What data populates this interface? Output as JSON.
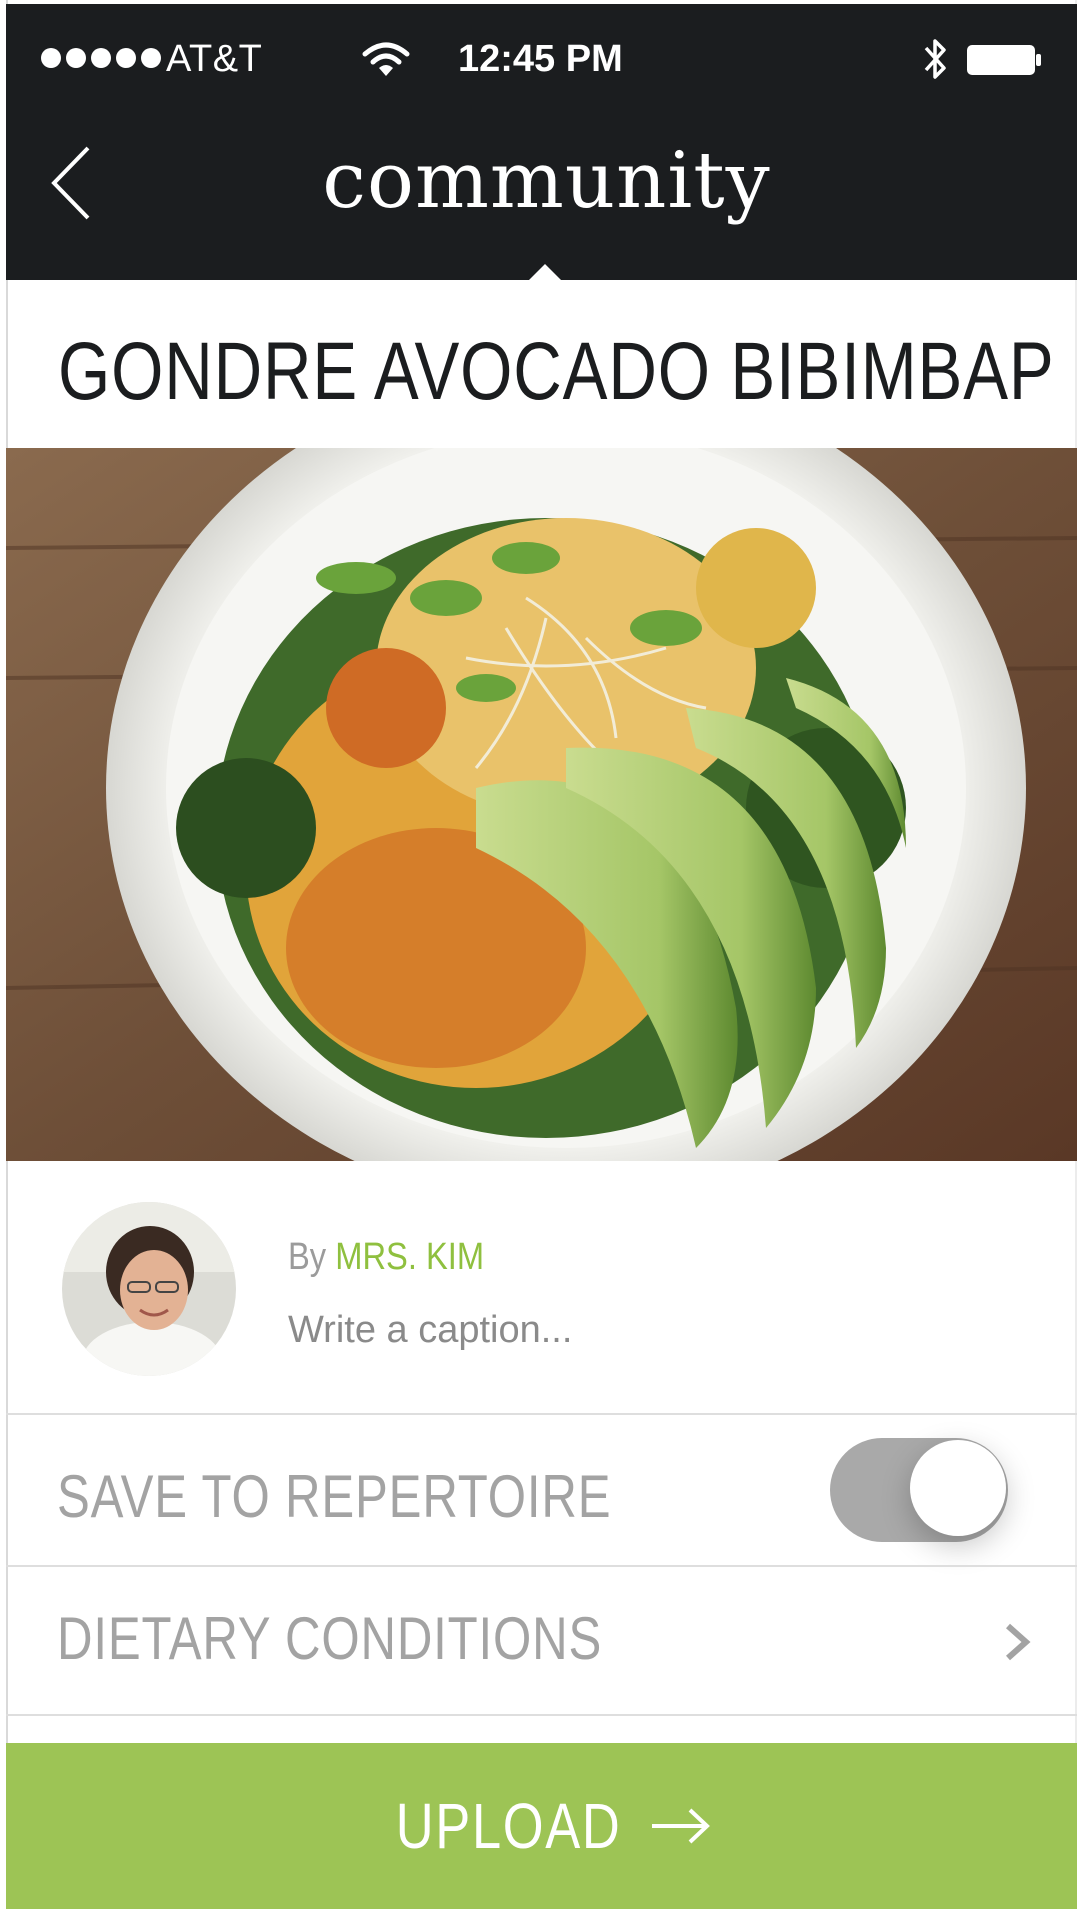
{
  "status_bar": {
    "carrier": "AT&T",
    "time": "12:45 PM",
    "signal_bars": 5,
    "icons": [
      "wifi-icon",
      "bluetooth-icon",
      "battery-icon"
    ]
  },
  "nav": {
    "title": "community",
    "back_icon": "chevron-left-icon"
  },
  "recipe": {
    "title": "GONDRE AVOCADO BIBIMBAP"
  },
  "author": {
    "by_prefix": "By",
    "name": "MRS. KIM"
  },
  "caption": {
    "placeholder": "Write a caption..."
  },
  "options": {
    "save_to_repertoire_label": "SAVE TO REPERTOIRE",
    "save_to_repertoire_on": true,
    "dietary_conditions_label": "DIETARY CONDITIONS",
    "dietary_icon": "chevron-right-icon"
  },
  "upload": {
    "label": "UPLOAD",
    "icon": "arrow-right-icon"
  },
  "colors": {
    "header_bg": "#1b1d1f",
    "accent_green": "#9dc455",
    "author_green": "#8fc03f",
    "muted_text": "#a3a3a3",
    "toggle_track": "#a9a9a9"
  }
}
